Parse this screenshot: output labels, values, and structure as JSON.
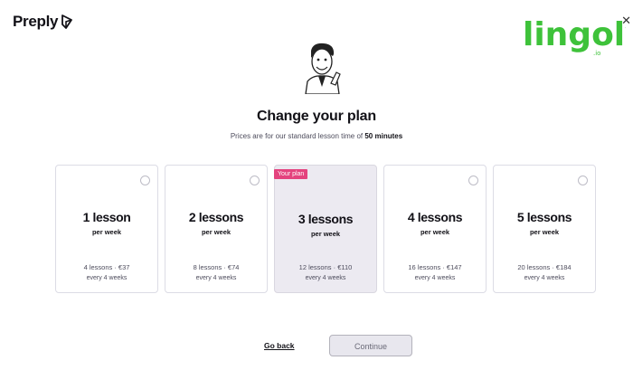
{
  "brand": {
    "name": "Preply"
  },
  "watermark": {
    "text": "lingoly",
    "suffix": ".io"
  },
  "header": {
    "title": "Change your plan",
    "subtitle_prefix": "Prices are for our standard lesson time of ",
    "subtitle_bold": "50 minutes"
  },
  "plans": [
    {
      "count": "1 lesson",
      "frequency": "per week",
      "price": "4 lessons · €37",
      "period": "every 4 weeks",
      "selected": false
    },
    {
      "count": "2 lessons",
      "frequency": "per week",
      "price": "8 lessons · €74",
      "period": "every 4 weeks",
      "selected": false
    },
    {
      "count": "3 lessons",
      "frequency": "per week",
      "price": "12 lessons · €110",
      "period": "every 4 weeks",
      "selected": true,
      "badge": "Your plan"
    },
    {
      "count": "4 lessons",
      "frequency": "per week",
      "price": "16 lessons · €147",
      "period": "every 4 weeks",
      "selected": false
    },
    {
      "count": "5 lessons",
      "frequency": "per week",
      "price": "20 lessons · €184",
      "period": "every 4 weeks",
      "selected": false
    }
  ],
  "actions": {
    "back_label": "Go back",
    "continue_label": "Continue"
  },
  "colors": {
    "badge": "#e4437e",
    "selected_card": "#eceaf1",
    "watermark_green": "#3ec23a"
  }
}
